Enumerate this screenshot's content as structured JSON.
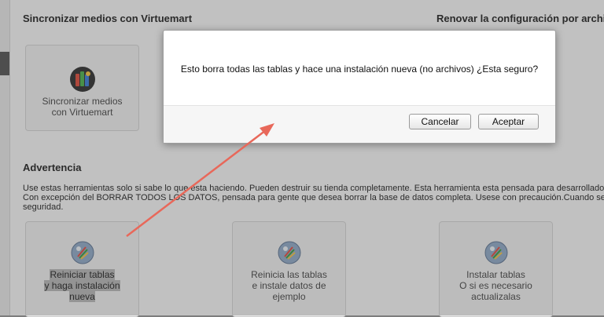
{
  "sections": {
    "sync_title": "Sincronizar medios con Virtuemart",
    "renew_title": "Renovar la configuración por archi",
    "warning_title": "Advertencia"
  },
  "sync_box": {
    "label_line1": "Sincronizar medios",
    "label_line2": "con Virtuemart"
  },
  "warning_text": {
    "line1": "Use estas herramientas solo si sabe lo que esta haciendo. Pueden destruir su tienda completamente. Esta herramienta esta pensada para desarrollado",
    "line2": "Con excepción del BORRAR TODOS LOS DATOS, pensada para gente que desea borrar la base de datos completa. Usese con precaución.Cuando se",
    "line3": "seguridad."
  },
  "tools": [
    {
      "line1": "Reiniciar tablas",
      "line2": "y haga instalación",
      "line3": "nueva"
    },
    {
      "line1": "Reinicia las tablas",
      "line2": "e instale datos de",
      "line3": "ejemplo"
    },
    {
      "line1": "Instalar tablas",
      "line2": "O si es necesario",
      "line3": "actualizalas"
    }
  ],
  "dialog": {
    "message": "Esto borra todas las tablas y hace una instalación nueva (no archivos) ¿Esta seguro?",
    "cancel_label": "Cancelar",
    "accept_label": "Aceptar"
  },
  "colors": {
    "arrow": "#e8685a",
    "dialog_bg": "#ffffff",
    "page_bg": "#f2f2f2"
  }
}
